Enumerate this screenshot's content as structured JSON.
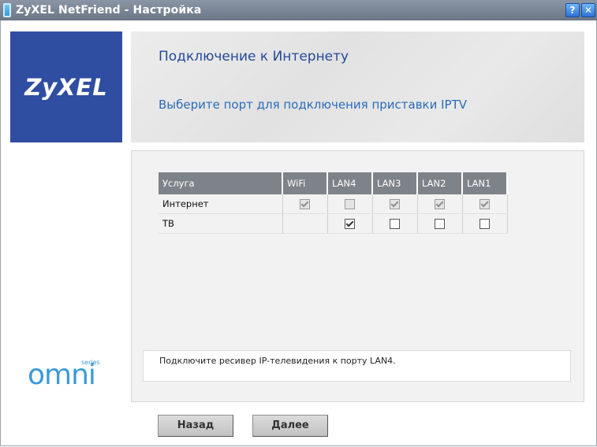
{
  "window": {
    "title": "ZyXEL NetFriend - Настройка",
    "help_label": "?",
    "close_label": "✕"
  },
  "brand": {
    "logo_text": "ZyXEL",
    "series_small": "series",
    "series_word": "omni"
  },
  "header": {
    "title": "Подключение к Интернету",
    "subtitle": "Выберите порт для подключения приставки IPTV"
  },
  "table": {
    "columns": [
      "Услуга",
      "WiFi",
      "LAN4",
      "LAN3",
      "LAN2",
      "LAN1"
    ],
    "rows": [
      {
        "service": "Интернет",
        "ports": [
          {
            "checked": true,
            "disabled": true
          },
          {
            "checked": false,
            "disabled": true
          },
          {
            "checked": true,
            "disabled": true
          },
          {
            "checked": true,
            "disabled": true
          },
          {
            "checked": true,
            "disabled": true
          }
        ]
      },
      {
        "service": "ТВ",
        "ports": null,
        "ports_tv": [
          {
            "checked": false,
            "disabled": false,
            "visible": false
          },
          {
            "checked": true,
            "disabled": false,
            "visible": true
          },
          {
            "checked": false,
            "disabled": false,
            "visible": true
          },
          {
            "checked": false,
            "disabled": false,
            "visible": true
          },
          {
            "checked": false,
            "disabled": false,
            "visible": true
          }
        ]
      }
    ]
  },
  "info": {
    "message": "Подключите ресивер IP-телевидения к порту LAN4."
  },
  "buttons": {
    "back": "Назад",
    "next": "Далее"
  },
  "colors": {
    "logo_bg": "#2f4da1",
    "header_title": "#234a98",
    "table_header": "#7e8389"
  }
}
